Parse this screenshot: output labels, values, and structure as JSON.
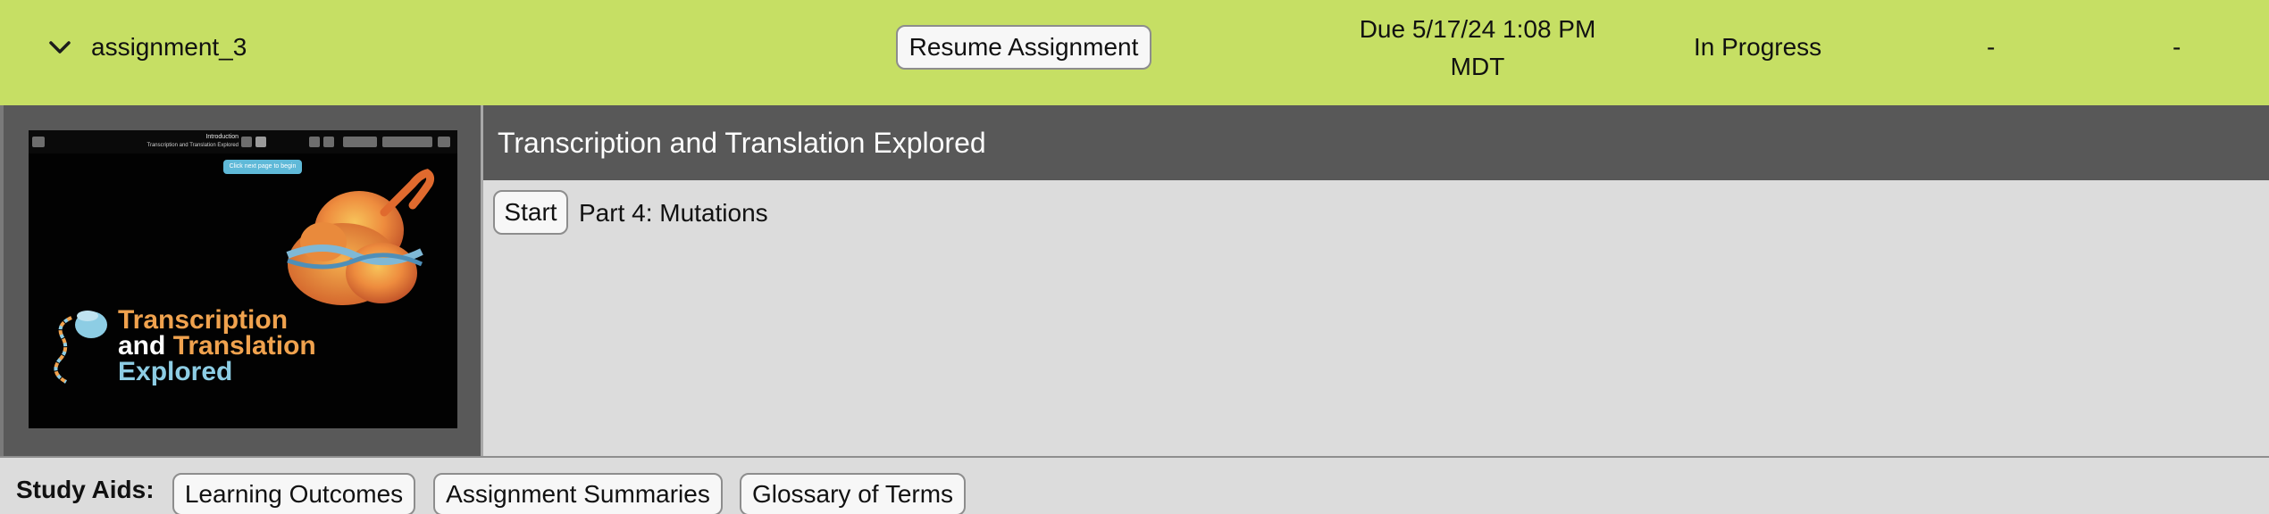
{
  "assignment": {
    "name": "assignment_3",
    "resume_label": "Resume Assignment",
    "due_line1": "Due 5/17/24 1:08 PM",
    "due_line2": "MDT",
    "status": "In Progress",
    "col1": "-",
    "col2": "-"
  },
  "thumbnail": {
    "nav_title": "Introduction",
    "nav_subtitle": "Transcription and Translation Explored",
    "tooltip": "Click next page to begin",
    "title_word1": "Transcription",
    "title_and": "and",
    "title_word2": "Translation",
    "title_word3": "Explored"
  },
  "content": {
    "title": "Transcription and Translation Explored",
    "start_label": "Start",
    "part_label": "Part 4: Mutations"
  },
  "study_aids": {
    "label": "Study Aids:",
    "buttons": [
      "Learning Outcomes",
      "Assignment Summaries",
      "Glossary of Terms"
    ]
  },
  "icons": {
    "expand": "chevron-down-icon"
  },
  "colors": {
    "header_bg": "#c6df64",
    "title_bar_bg": "#585858",
    "panel_bg": "#dcdcdc",
    "accent_orange": "#f0a24e",
    "accent_blue": "#8dcde4"
  }
}
